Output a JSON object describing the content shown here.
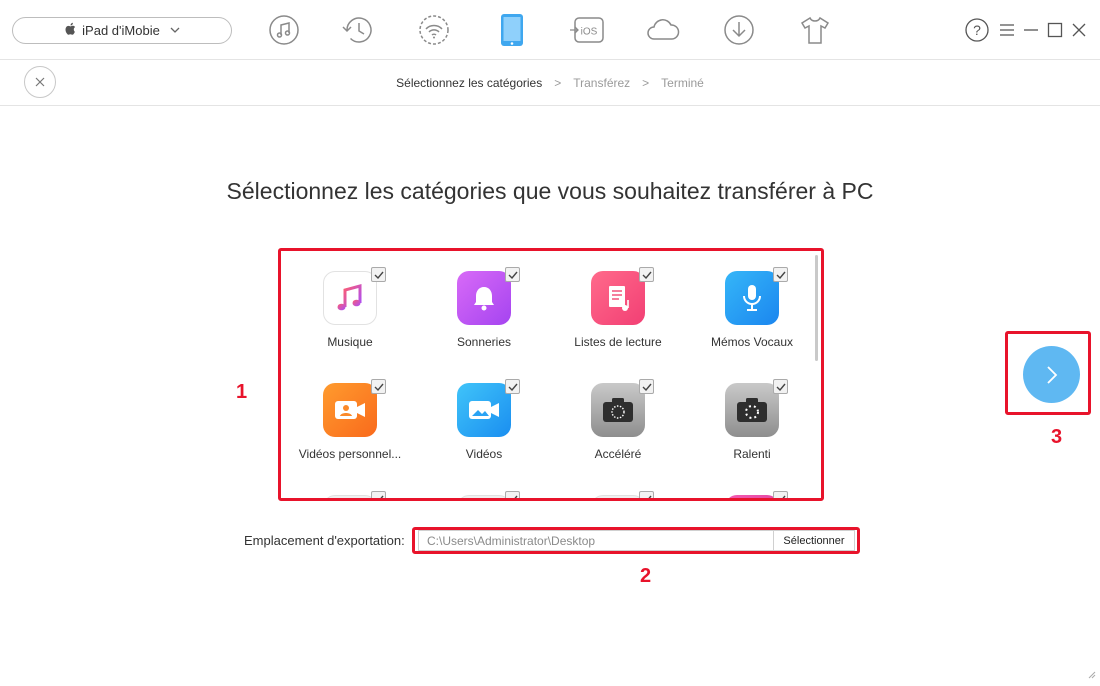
{
  "toolbar": {
    "device_name": "iPad d'iMobie",
    "icons": [
      "music-icon",
      "history-icon",
      "wifi-icon",
      "ipad-icon",
      "ios-icon",
      "cloud-icon",
      "download-icon",
      "tshirt-icon"
    ],
    "ios_text": "iOS",
    "help_symbol": "?"
  },
  "breadcrumb": {
    "step1": "Sélectionnez les catégories",
    "sep": ">",
    "step2": "Transférez",
    "step3": "Terminé"
  },
  "main": {
    "headline": "Sélectionnez les catégories que vous souhaitez transférer à PC",
    "categories": [
      {
        "label": "Musique",
        "icon": "music-note-icon",
        "checked": true
      },
      {
        "label": "Sonneries",
        "icon": "bell-icon",
        "checked": true
      },
      {
        "label": "Listes de lecture",
        "icon": "playlist-icon",
        "checked": true
      },
      {
        "label": "Mémos Vocaux",
        "icon": "microphone-icon",
        "checked": true
      },
      {
        "label": "Vidéos personnel...",
        "icon": "personal-video-icon",
        "checked": true
      },
      {
        "label": "Vidéos",
        "icon": "video-camera-icon",
        "checked": true
      },
      {
        "label": "Accéléré",
        "icon": "timelapse-icon",
        "checked": true
      },
      {
        "label": "Ralenti",
        "icon": "slowmo-icon",
        "checked": true
      }
    ],
    "export_label": "Emplacement d'exportation:",
    "export_path": "C:\\Users\\Administrator\\Desktop",
    "export_button": "Sélectionner"
  },
  "annotations": {
    "grid": "1",
    "export": "2",
    "next": "3"
  },
  "colors": {
    "highlight": "#e8132b",
    "next_button": "#5fb8f2"
  }
}
